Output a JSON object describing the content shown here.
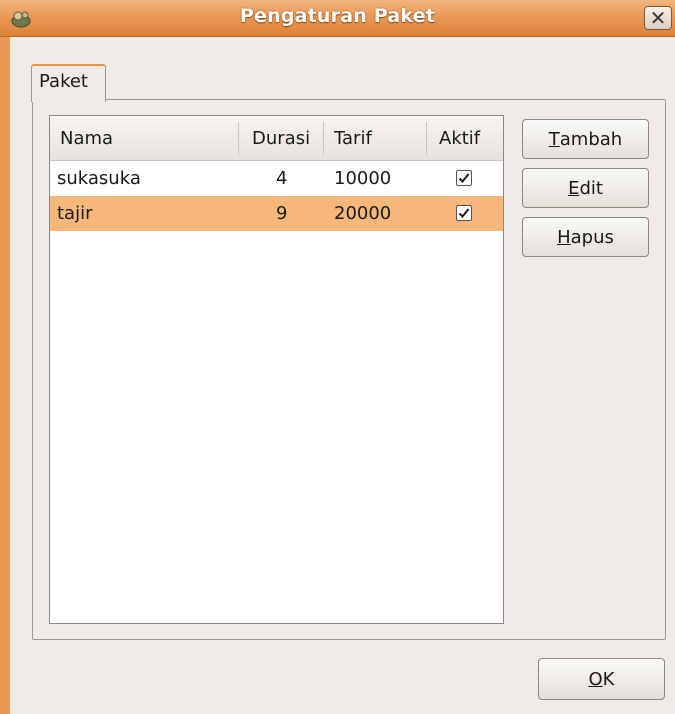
{
  "window": {
    "title": "Pengaturan Paket",
    "close_glyph": "✕"
  },
  "tabs": [
    {
      "label": "Paket",
      "active": true
    }
  ],
  "table": {
    "columns": [
      "Nama",
      "Durasi",
      "Tarif",
      "Aktif"
    ],
    "rows": [
      {
        "nama": "sukasuka",
        "durasi": "4",
        "tarif": "10000",
        "aktif": true,
        "selected": false
      },
      {
        "nama": "tajir",
        "durasi": "9",
        "tarif": "20000",
        "aktif": true,
        "selected": true
      }
    ]
  },
  "buttons": {
    "tambah": {
      "mnemonic": "T",
      "rest": "ambah"
    },
    "edit": {
      "mnemonic": "E",
      "rest": "dit"
    },
    "hapus": {
      "mnemonic": "H",
      "rest": "apus"
    },
    "ok": {
      "mnemonic": "O",
      "rest": "K"
    }
  },
  "colors": {
    "titlebar": "#e99a56",
    "selection": "#f7b77a",
    "tab_accent": "#e8944d"
  },
  "icons": {
    "app": "gnome-app-icon",
    "close": "close-icon",
    "check": "checkmark-icon"
  }
}
